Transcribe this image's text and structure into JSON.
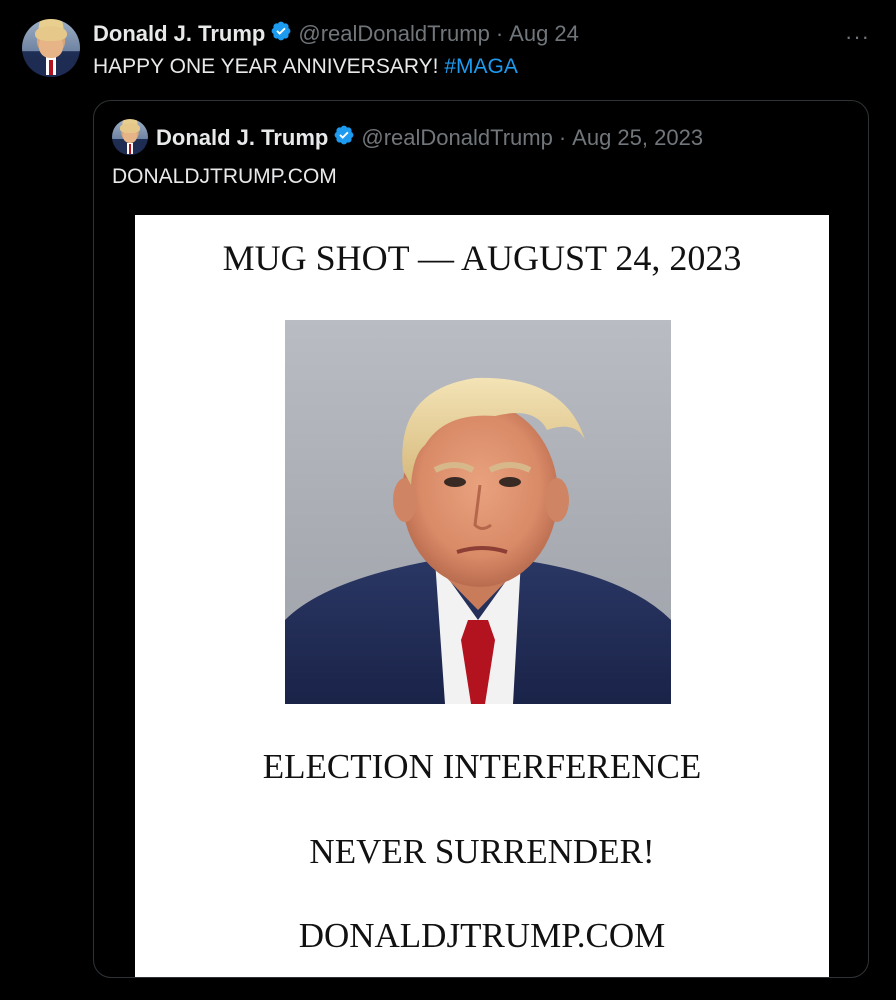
{
  "tweet": {
    "author_name": "Donald J. Trump",
    "handle": "@realDonaldTrump",
    "separator": "·",
    "date": "Aug 24",
    "text": "HAPPY ONE YEAR ANNIVERSARY! ",
    "hashtag": "#MAGA",
    "more_label": "···",
    "verified_icon": "verified-badge-icon",
    "colors": {
      "verified": "#1d9bf0",
      "hashtag": "#1d9bf0",
      "meta": "#71767b",
      "text": "#e7e9ea",
      "background": "#000000"
    }
  },
  "quoted_tweet": {
    "author_name": "Donald J. Trump",
    "handle": "@realDonaldTrump",
    "separator": "·",
    "date": "Aug 25, 2023",
    "text": "DONALDJTRUMP.COM",
    "image": {
      "title": "MUG SHOT — AUGUST 24, 2023",
      "line1": "ELECTION INTERFERENCE",
      "line2": "NEVER SURRENDER!",
      "line3": "DONALDJTRUMP.COM"
    }
  }
}
